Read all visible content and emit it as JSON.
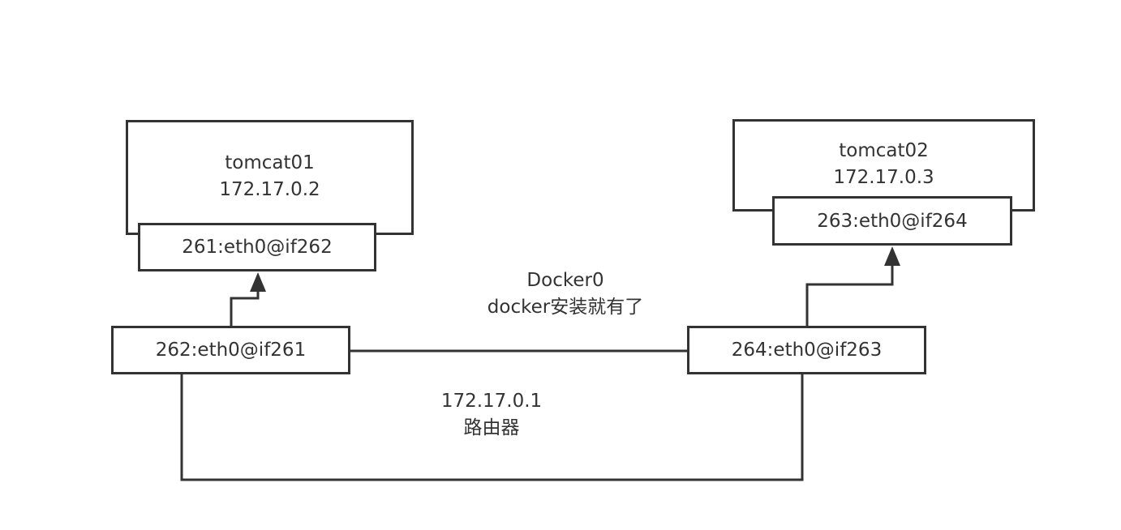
{
  "container_left": {
    "name": "tomcat01",
    "ip": "172.17.0.2",
    "interface": "261:eth0@if262"
  },
  "container_right": {
    "name": "tomcat02",
    "ip": "172.17.0.3",
    "interface": "263:eth0@if264"
  },
  "bridge": {
    "name": "Docker0",
    "note": "docker安装就有了",
    "ip": "172.17.0.1",
    "role": "路由器",
    "veth_left": "262:eth0@if261",
    "veth_right": "264:eth0@if263"
  },
  "colors": {
    "stroke": "#333333",
    "background": "#ffffff"
  }
}
